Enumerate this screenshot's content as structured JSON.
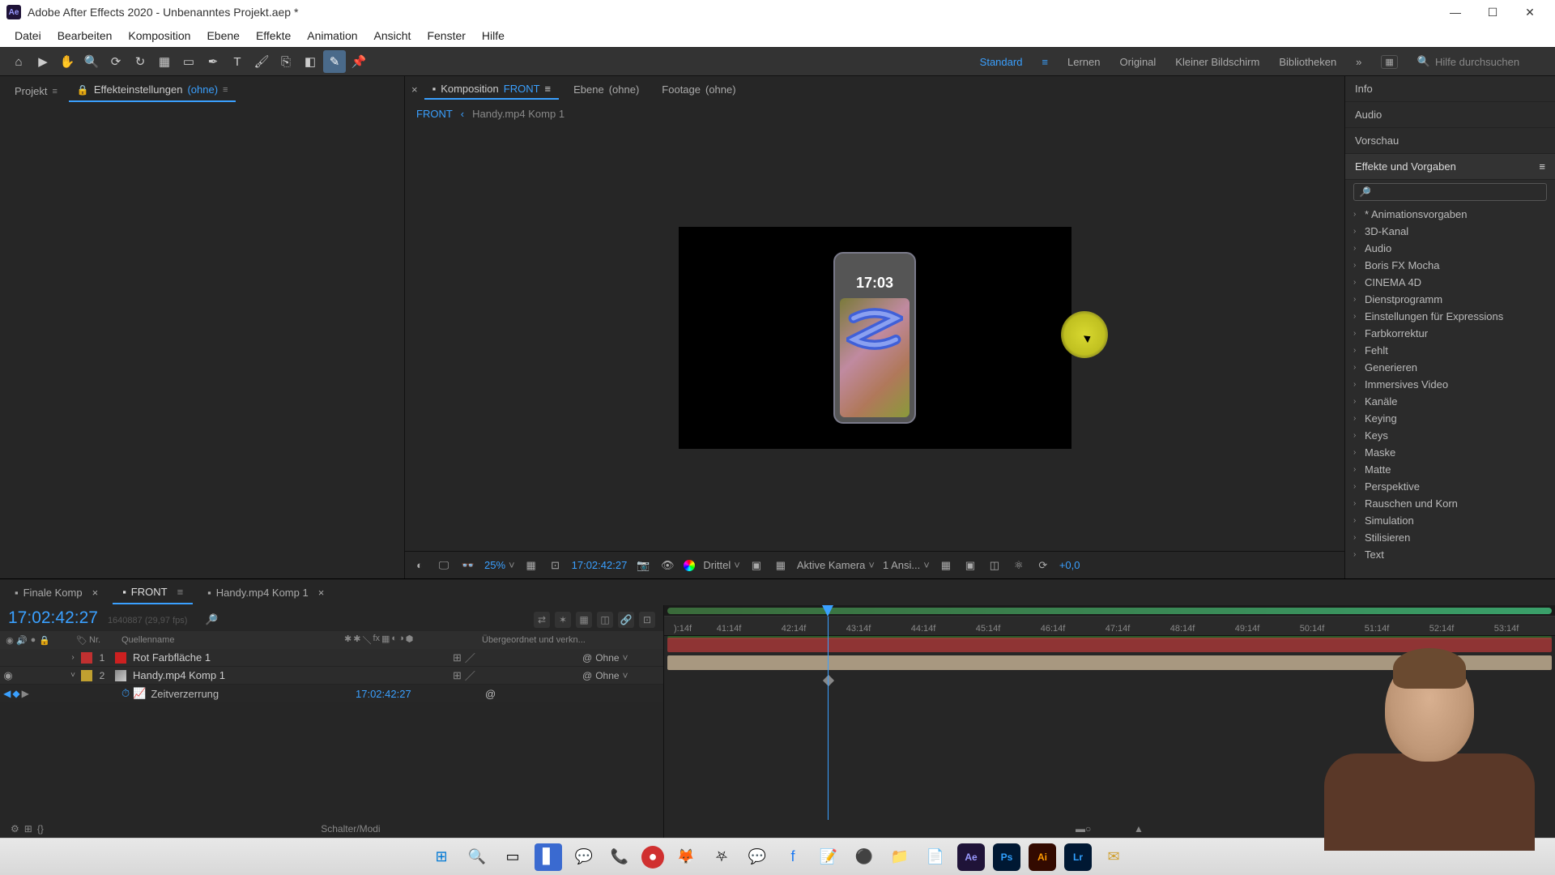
{
  "app": {
    "title": "Adobe After Effects 2020 - Unbenanntes Projekt.aep *"
  },
  "menu": [
    "Datei",
    "Bearbeiten",
    "Komposition",
    "Ebene",
    "Effekte",
    "Animation",
    "Ansicht",
    "Fenster",
    "Hilfe"
  ],
  "workspaces": [
    "Standard",
    "Lernen",
    "Original",
    "Kleiner Bildschirm",
    "Bibliotheken"
  ],
  "active_workspace": "Standard",
  "search_placeholder": "Hilfe durchsuchen",
  "left_tabs": {
    "project": "Projekt",
    "effect_controls": "Effekteinstellungen",
    "effect_controls_sub": "(ohne)"
  },
  "comp_tabs": {
    "composition": "Komposition",
    "composition_name": "FRONT",
    "layer": "Ebene",
    "layer_sub": "(ohne)",
    "footage": "Footage",
    "footage_sub": "(ohne)"
  },
  "breadcrumb": {
    "a": "FRONT",
    "b": "Handy.mp4 Komp 1"
  },
  "phone_time": "17:03",
  "viewer": {
    "zoom": "25%",
    "timecode": "17:02:42:27",
    "quality": "Drittel",
    "camera": "Aktive Kamera",
    "views": "1 Ansi...",
    "plus": "+0,0"
  },
  "right_panels": {
    "info": "Info",
    "audio": "Audio",
    "preview": "Vorschau",
    "effects": "Effekte und Vorgaben"
  },
  "effects_tree": [
    "* Animationsvorgaben",
    "3D-Kanal",
    "Audio",
    "Boris FX Mocha",
    "CINEMA 4D",
    "Dienstprogramm",
    "Einstellungen für Expressions",
    "Farbkorrektur",
    "Fehlt",
    "Generieren",
    "Immersives Video",
    "Kanäle",
    "Keying",
    "Keys",
    "Maske",
    "Matte",
    "Perspektive",
    "Rauschen und Korn",
    "Simulation",
    "Stilisieren",
    "Text"
  ],
  "timeline_tabs": [
    {
      "label": "Finale Komp",
      "sel": false
    },
    {
      "label": "FRONT",
      "sel": true
    },
    {
      "label": "Handy.mp4 Komp 1",
      "sel": false
    }
  ],
  "timeline": {
    "timecode": "17:02:42:27",
    "fps": "1640887 (29,97 fps)",
    "col_nr": "Nr.",
    "col_name": "Quellenname",
    "col_parent": "Übergeordnet und verkn...",
    "footer": "Schalter/Modi",
    "layer1": {
      "num": "1",
      "name": "Rot Farbfläche 1",
      "mode": "Ohne",
      "color": "#cc2020"
    },
    "layer2": {
      "num": "2",
      "name": "Handy.mp4 Komp 1",
      "mode": "Ohne"
    },
    "sub": {
      "label": "Zeitverzerrung",
      "value": "17:02:42:27"
    },
    "ticks": [
      "41:14f",
      "42:14f",
      "43:14f",
      "44:14f",
      "45:14f",
      "46:14f",
      "47:14f",
      "48:14f",
      "49:14f",
      "50:14f",
      "51:14f",
      "52:14f",
      "53:14f"
    ]
  }
}
